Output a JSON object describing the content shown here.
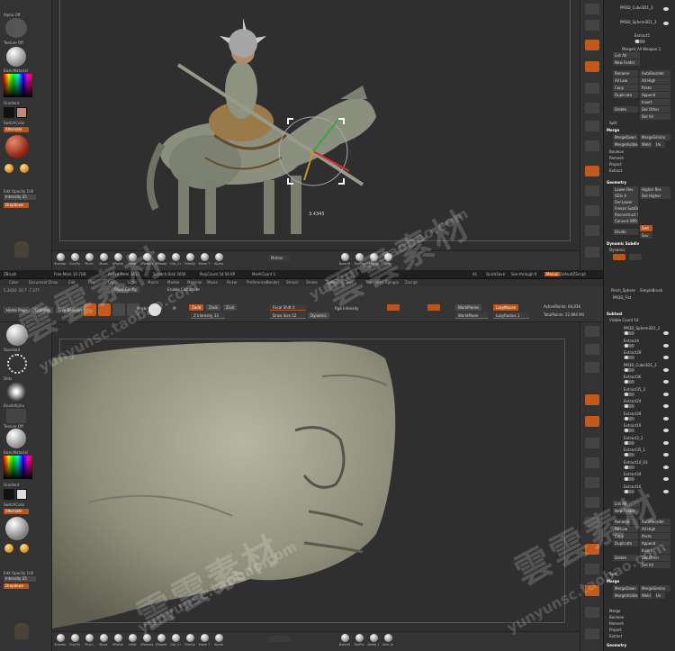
{
  "top": {
    "left": {
      "alpha_label": "Alpha Off",
      "texture_label": "Texture Off",
      "material_label": "BasicMaterial",
      "gradient_label": "Gradient",
      "switch_label": "SwitchColor",
      "alternate_label": "Alternate",
      "edit_opacity": "Edit Opacity 100",
      "intensity_label": "Intensity 25",
      "rgb_label": "Rgb Int. 5",
      "draw_label": "Dropdown"
    },
    "canvas": {
      "gizmo_readout": "3.4345",
      "bottom_label": "Motion"
    },
    "brushes": [
      {
        "label": "Standar"
      },
      {
        "label": "ClayTul"
      },
      {
        "label": "Pinch"
      },
      {
        "label": "Move"
      },
      {
        "label": "hPolish"
      },
      {
        "label": "Inflat"
      },
      {
        "label": "ZRemes"
      },
      {
        "label": "ZModel"
      },
      {
        "label": "Orb_Cr"
      },
      {
        "label": "TrimDy"
      },
      {
        "label": "Move T"
      },
      {
        "label": "Alpha"
      }
    ],
    "brushes_right": [
      {
        "label": "BasicM"
      },
      {
        "label": "ToyPla"
      },
      {
        "label": "Metal"
      },
      {
        "label": "Dots"
      }
    ],
    "rpanel": {
      "subtools": [
        "PM3D_Cube3D1_3",
        "PM3D_Sphere3D1_3"
      ],
      "extract_label": "Extract5",
      "merged_label": "Merged_All Weapon 1",
      "list_all": "List All",
      "new_folder": "New Folder",
      "buttons": [
        [
          "Rename",
          "AutoReorder"
        ],
        [
          "All Low",
          "All High"
        ],
        [
          "Copy",
          "Paste"
        ],
        [
          "Duplicate",
          "Append"
        ],
        [
          "",
          "Insert"
        ],
        [
          "Delete",
          "Del Other"
        ],
        [
          "",
          "Del All"
        ]
      ],
      "split": "Split",
      "merge": "Merge",
      "merge_items": [
        "MergeDown",
        "MergeSimilar",
        "MergeVisible",
        "Weld",
        "Uv"
      ],
      "boolean": "Boolean",
      "remesh": "Remesh",
      "project": "Project",
      "extract": "Extract",
      "geometry": "Geometry",
      "geo_items": [
        [
          "Lower Res",
          "Higher Res"
        ],
        [
          "SDiv 4",
          "Del Higher"
        ],
        [
          "Del Lower",
          ""
        ],
        [
          "Freeze SubDivision Levels",
          ""
        ],
        [
          "Reconstruct Subdiv",
          ""
        ],
        [
          "Convert BPR To Geo",
          ""
        ]
      ],
      "divide": "Divide",
      "smt": "Smt",
      "suv": "Suv",
      "dynamic": "Dynamic Subdiv",
      "dynamic_item": "Dynamic"
    }
  },
  "bottom": {
    "header": {
      "app": "ZBrush",
      "free_mem": "Free Mem 10.7GB",
      "active_mem": "Active Mem 3413",
      "scratch": "Scratch Disk 3056",
      "polycount": "PolyCount 54.56 KP",
      "meshcount": "MeshCount 1",
      "ac": "AC",
      "quicksave": "QuickSave",
      "seethrough": "See-through 0",
      "menus": "Menus",
      "defaultscript": "DefaultZScript"
    },
    "menubar": [
      "Color",
      "Document",
      "Draw",
      "Edit",
      "File",
      "Layer",
      "Light",
      "Macro",
      "Marker",
      "Material",
      "Movie",
      "Picker",
      "Preferences",
      "Render",
      "Stencil",
      "Stroke",
      "Texture",
      "Tool",
      "Transform",
      "Zplugin",
      "Zscript"
    ],
    "status_left": "5.3430 -10.7 -7.377",
    "store_config": "Store Config",
    "enable_customize": "Enable Customize",
    "shelf": {
      "home": "Home Page",
      "lightbox": "LightBox",
      "live_boolean": "Live Boolean",
      "edit": "Edit",
      "draw": "Draw",
      "move": "Move",
      "scale": "Scale",
      "rotate": "Rotate",
      "mrgb": "Mrgb",
      "rgb": "Rgb",
      "m": "M",
      "zadd": "Zadd",
      "zsub": "Zsub",
      "zcut": "Zcut",
      "focal_shift": "Focal Shift 0",
      "draw_size": "Draw Size 52",
      "dynamic": "Dynamic",
      "rgb_intensity": "Rgb Intensity",
      "z_intensity": "Z Intensity 33",
      "active_points": "ActivePoints: 64,036",
      "total_points": "TotalPoints: 22.894 Mil",
      "laz_mouse": "LazyMouse",
      "laz_radius": "LazyRadius 1",
      "workflow": "WorkPlanes",
      "wire": "WorldPlane"
    },
    "left": {
      "std_label": "Standard",
      "dots_label": "Dots",
      "alpha_label": "BrushAlpha",
      "texture_label": "Texture Off",
      "material_label": "BasicMaterial",
      "gradient_label": "Gradient",
      "switch_label": "SwitchColor",
      "alternate_label": "Alternate",
      "edit_opacity": "Edit Opacity 100",
      "intensity_label": "Intensity 25",
      "draw_label": "Dropdown"
    },
    "brushes": [
      {
        "label": "Standar"
      },
      {
        "label": "ClayTul"
      },
      {
        "label": "Pinch"
      },
      {
        "label": "Move"
      },
      {
        "label": "hPolish"
      },
      {
        "label": "Inflat"
      },
      {
        "label": "ZRemes"
      },
      {
        "label": "ZModel"
      },
      {
        "label": "Orb_Cr"
      },
      {
        "label": "TrimDy"
      },
      {
        "label": "Move T"
      },
      {
        "label": "Alpha"
      }
    ],
    "brushes_right": [
      {
        "label": "BasicM"
      },
      {
        "label": "ToyPla"
      },
      {
        "label": "Metal 1"
      },
      {
        "label": "Skin_m"
      }
    ],
    "rpanel": {
      "top_label": "Pinch_Sphere",
      "simple_label": "SimpleBrush",
      "pm3d_label": "PM3D_Fist",
      "subtool": "Subtool",
      "visible_count": "Visible Count 14",
      "subtools": [
        "PM3D_Sphere3D1_2",
        "Extract4",
        "Extract29",
        "PM3D_Cube3D1_3",
        "Extract36",
        "Extract35_3",
        "Extract24",
        "Extract28",
        "Extract19",
        "Extract2_2",
        "Extract35_1",
        "Extract10_03",
        "Extract34",
        "Extract16"
      ],
      "list_all": "List All",
      "new_folder": "New Folder",
      "buttons": [
        [
          "Rename",
          "AutoReorder"
        ],
        [
          "All Low",
          "All High"
        ],
        [
          "Copy",
          "Paste"
        ],
        [
          "Duplicate",
          "Append"
        ],
        [
          "",
          "Insert"
        ],
        [
          "Delete",
          "Del Other"
        ],
        [
          "",
          "Del All"
        ]
      ],
      "split": "Split",
      "merge": "Merge",
      "merge_items": [
        "MergeDown",
        "MergeSimilar",
        "MergeVisible",
        "Weld",
        "Uv"
      ],
      "boolean": "Boolean",
      "remesh": "Remesh",
      "project": "Project",
      "extract": "Extract",
      "geometry": "Geometry"
    }
  },
  "watermarks": {
    "cn": "雲雲素材",
    "url": "yunyunsc.taobao.com"
  }
}
